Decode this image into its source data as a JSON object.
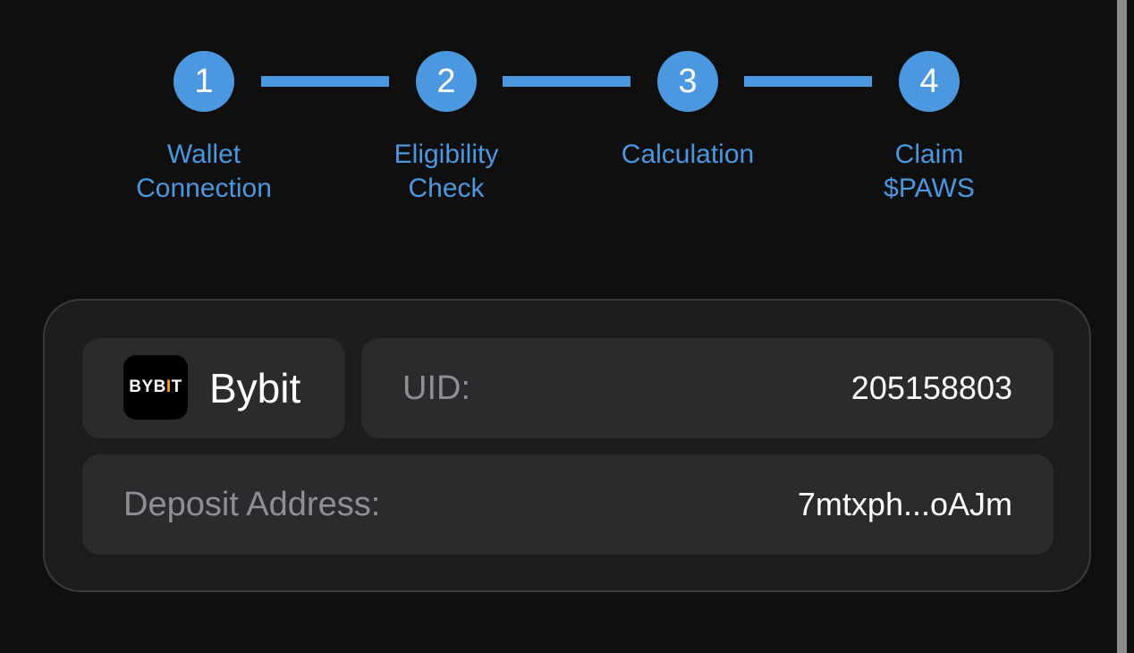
{
  "stepper": {
    "steps": [
      {
        "number": "1",
        "label_line1": "Wallet",
        "label_line2": "Connection"
      },
      {
        "number": "2",
        "label_line1": "Eligibility",
        "label_line2": "Check"
      },
      {
        "number": "3",
        "label_line1": "Calculation",
        "label_line2": ""
      },
      {
        "number": "4",
        "label_line1": "Claim",
        "label_line2": "$PAWS"
      }
    ]
  },
  "exchange": {
    "logo_text_before": "BYB",
    "logo_text_accent": "I",
    "logo_text_after": "T",
    "name": "Bybit",
    "icon": "bybit-logo"
  },
  "uid": {
    "label": "UID:",
    "value": "205158803"
  },
  "deposit": {
    "label": "Deposit Address:",
    "value": "7mtxph...oAJm"
  },
  "colors": {
    "background": "#0f0f10",
    "accent": "#4b97e0",
    "card": "#1d1d20",
    "tile": "#2b2b2e",
    "muted_text": "#8e8e93",
    "bybit_accent": "#f7a600"
  }
}
